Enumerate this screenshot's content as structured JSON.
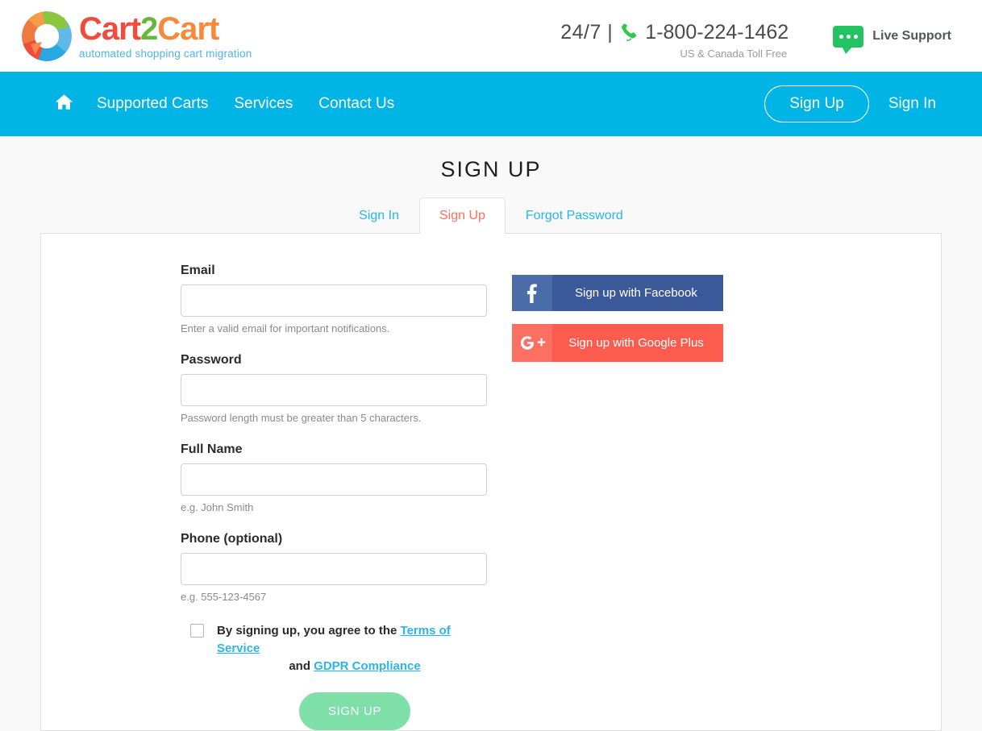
{
  "brand": {
    "logo_word_1": "Cart",
    "logo_word_2": "2",
    "logo_word_3": "Cart",
    "tagline": "automated shopping cart migration",
    "logo_icon": "cart2cart-swirl-logo"
  },
  "header": {
    "phone_prefix": "24/7 |",
    "phone_number": "1-800-224-1462",
    "phone_sub": "US & Canada Toll Free",
    "phone_icon": "phone-icon",
    "support_label": "Live Support",
    "support_icon": "chat-bubble-icon"
  },
  "nav": {
    "home_icon": "home-icon",
    "links": [
      {
        "label": "Supported Carts"
      },
      {
        "label": "Services"
      },
      {
        "label": "Contact Us"
      }
    ],
    "signup_label": "Sign Up",
    "signin_label": "Sign In"
  },
  "page": {
    "title": "SIGN UP"
  },
  "tabs": [
    {
      "label": "Sign In",
      "active": false
    },
    {
      "label": "Sign Up",
      "active": true
    },
    {
      "label": "Forgot Password",
      "active": false
    }
  ],
  "form": {
    "email": {
      "label": "Email",
      "value": "",
      "placeholder": "",
      "help": "Enter a valid email for important notifications."
    },
    "password": {
      "label": "Password",
      "value": "",
      "placeholder": "",
      "help": "Password length must be greater than 5 characters."
    },
    "full_name": {
      "label": "Full Name",
      "value": "",
      "placeholder": "",
      "help": "e.g. John Smith"
    },
    "phone": {
      "label": "Phone (optional)",
      "value": "",
      "placeholder": "",
      "help": "e.g. 555-123-4567"
    },
    "terms": {
      "checked": false,
      "text_before": "By signing up, you agree to the",
      "link_terms": "Terms of Service",
      "text_and": "and",
      "link_gdpr": "GDPR Compliance"
    },
    "submit_label": "SIGN UP"
  },
  "social": {
    "facebook": {
      "label": "Sign up with Facebook",
      "icon": "facebook-icon"
    },
    "google_plus": {
      "label": "Sign up with Google Plus",
      "icon": "google-plus-icon"
    }
  },
  "colors": {
    "nav_blue": "#00b5e6",
    "link_blue": "#29b6e8",
    "active_tab_red": "#fb6d5d",
    "submit_green": "#7ee0a8",
    "facebook_blue": "#3b5998",
    "google_red": "#fb5c4e",
    "support_green": "#23c262",
    "page_bg": "#f9f9f9"
  }
}
